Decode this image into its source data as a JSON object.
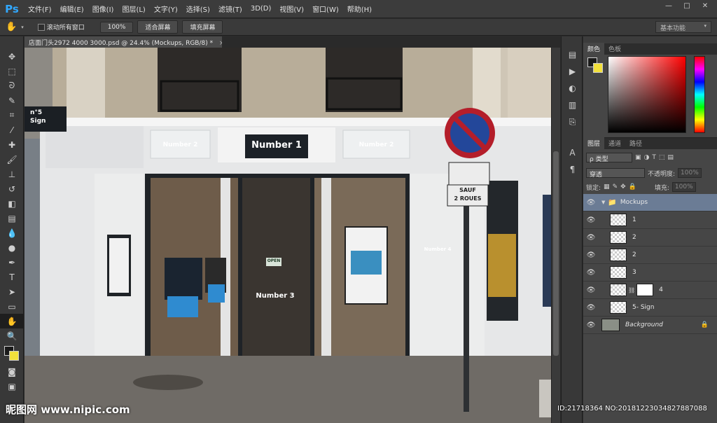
{
  "app": {
    "logo": "Ps"
  },
  "menu": [
    "文件(F)",
    "编辑(E)",
    "图像(I)",
    "图层(L)",
    "文字(Y)",
    "选择(S)",
    "滤镜(T)",
    "3D(D)",
    "视图(V)",
    "窗口(W)",
    "帮助(H)"
  ],
  "window_controls": {
    "minimize": "—",
    "maximize": "□",
    "close": "✕"
  },
  "options": {
    "scroll_all": "滚动所有窗口",
    "zoom_100": "100%",
    "fit_screen": "适合屏幕",
    "fill_screen": "填充屏幕",
    "workspace": "基本功能"
  },
  "document": {
    "tab_title": "店面门头2972 4000 3000.psd @ 24.4% (Mockups, RGB/8) *",
    "close": "×"
  },
  "scene": {
    "sign_main": "Number 1",
    "sign_left": "Number 2",
    "sign_right": "Number 2",
    "sign_window": "Number 3",
    "sign_pillar": "Number 4",
    "hanging_sign_line1": "n°5",
    "hanging_sign_line2": "Sign",
    "open_sign": "OPEN",
    "street_sign_line1": "SAUF",
    "street_sign_line2": "2 ROUES"
  },
  "color_panel": {
    "tabs": [
      "颜色",
      "色板"
    ],
    "fg_color": "#1a1a1a",
    "bg_color": "#f2e03c"
  },
  "layers_panel": {
    "tabs": [
      "图层",
      "通道",
      "路径"
    ],
    "kind_filter": "ρ 类型",
    "blend_mode": "穿透",
    "opacity_label": "不透明度:",
    "opacity_value": "100%",
    "lock_label": "锁定:",
    "fill_label": "填充:",
    "fill_value": "100%",
    "layers": [
      {
        "name": "Mockups",
        "type": "group",
        "selected": true
      },
      {
        "name": "1",
        "type": "smart"
      },
      {
        "name": "2",
        "type": "smart"
      },
      {
        "name": "2",
        "type": "smart"
      },
      {
        "name": "3",
        "type": "smart"
      },
      {
        "name": "4",
        "type": "smart-mask"
      },
      {
        "name": "5- Sign",
        "type": "smart"
      },
      {
        "name": "Background",
        "type": "background",
        "locked": true
      }
    ]
  },
  "watermark": {
    "left": "昵图网 www.nipic.com",
    "right": "ID:21718364 NO:20181223034827887088"
  }
}
